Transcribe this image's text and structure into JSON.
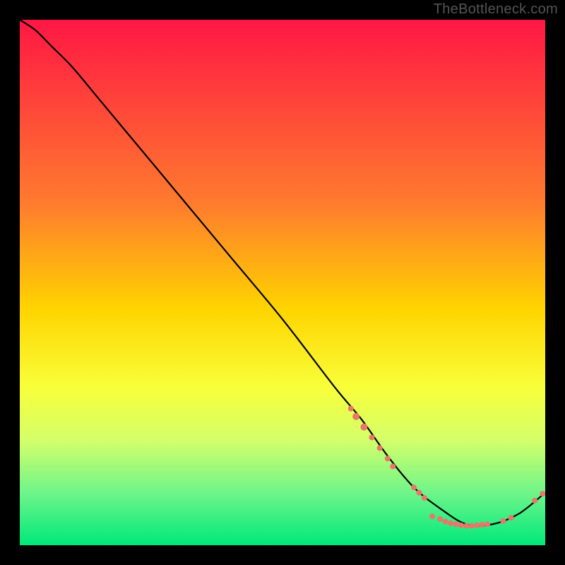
{
  "watermark": "TheBottleneck.com",
  "chart_data": {
    "type": "line",
    "title": "",
    "xlabel": "",
    "ylabel": "",
    "xlim": [
      0,
      100
    ],
    "ylim": [
      0,
      100
    ],
    "gradient_stops": [
      {
        "offset": 0,
        "color": "#ff1744"
      },
      {
        "offset": 35,
        "color": "#ff7b2e"
      },
      {
        "offset": 55,
        "color": "#ffd400"
      },
      {
        "offset": 70,
        "color": "#f8ff3a"
      },
      {
        "offset": 80,
        "color": "#d4ff6a"
      },
      {
        "offset": 90,
        "color": "#6ff58a"
      },
      {
        "offset": 100,
        "color": "#00e87a"
      }
    ],
    "series": [
      {
        "name": "curve",
        "color": "#000000",
        "x": [
          0,
          3,
          6,
          10,
          15,
          20,
          30,
          40,
          50,
          60,
          65,
          70,
          75,
          80,
          85,
          90,
          95,
          100
        ],
        "y": [
          100,
          98,
          95,
          91,
          85,
          79,
          67,
          55,
          43,
          30,
          24,
          17,
          11,
          7,
          4,
          4,
          6,
          10
        ]
      }
    ],
    "markers": {
      "name": "highlighted-points",
      "color": "#e8766a",
      "radius_small": 4,
      "radius_large": 6,
      "points": [
        {
          "x": 63,
          "y": 26,
          "r": 4
        },
        {
          "x": 64,
          "y": 24.5,
          "r": 5
        },
        {
          "x": 65.5,
          "y": 22.5,
          "r": 5
        },
        {
          "x": 67,
          "y": 20.5,
          "r": 4
        },
        {
          "x": 68.5,
          "y": 18.5,
          "r": 4
        },
        {
          "x": 70,
          "y": 16.5,
          "r": 4
        },
        {
          "x": 71,
          "y": 15,
          "r": 4
        },
        {
          "x": 75,
          "y": 11,
          "r": 4
        },
        {
          "x": 76,
          "y": 10,
          "r": 4
        },
        {
          "x": 77,
          "y": 9,
          "r": 4
        },
        {
          "x": 78.5,
          "y": 5.5,
          "r": 4
        },
        {
          "x": 80,
          "y": 5,
          "r": 4
        },
        {
          "x": 81,
          "y": 4.5,
          "r": 4
        },
        {
          "x": 82,
          "y": 4.2,
          "r": 4
        },
        {
          "x": 83,
          "y": 4,
          "r": 4
        },
        {
          "x": 84,
          "y": 3.8,
          "r": 4
        },
        {
          "x": 85,
          "y": 3.7,
          "r": 4
        },
        {
          "x": 86,
          "y": 3.7,
          "r": 4
        },
        {
          "x": 87,
          "y": 3.8,
          "r": 4
        },
        {
          "x": 88,
          "y": 3.9,
          "r": 4
        },
        {
          "x": 89,
          "y": 4,
          "r": 4
        },
        {
          "x": 92,
          "y": 4.6,
          "r": 4
        },
        {
          "x": 93.5,
          "y": 5.2,
          "r": 4
        },
        {
          "x": 98,
          "y": 8.5,
          "r": 4
        },
        {
          "x": 99.5,
          "y": 9.8,
          "r": 4
        }
      ]
    }
  }
}
